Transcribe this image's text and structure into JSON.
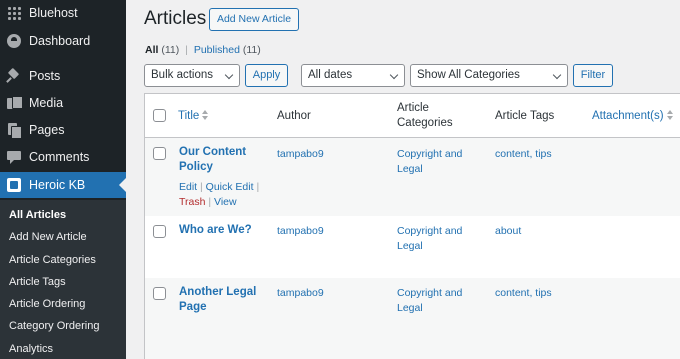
{
  "sidebar": {
    "top_items": [
      {
        "label": "Bluehost",
        "icon": "grid-icon"
      },
      {
        "label": "Dashboard",
        "icon": "dashboard-icon"
      },
      {
        "label": "Posts",
        "icon": "pin-icon"
      },
      {
        "label": "Media",
        "icon": "media-icon"
      },
      {
        "label": "Pages",
        "icon": "pages-icon"
      },
      {
        "label": "Comments",
        "icon": "comment-icon"
      },
      {
        "label": "Heroic KB",
        "icon": "kb-icon"
      }
    ],
    "submenu": [
      "All Articles",
      "Add New Article",
      "Article Categories",
      "Article Tags",
      "Article Ordering",
      "Category Ordering",
      "Analytics"
    ],
    "colors": {
      "background": "#1d2327",
      "current": "#2271b1",
      "submenu": "#2c3338"
    }
  },
  "header": {
    "title": "Articles",
    "add_new_label": "Add New Article"
  },
  "views": {
    "all_label": "All",
    "all_count": "(11)",
    "separator": "|",
    "published_label": "Published",
    "published_count": "(11)"
  },
  "filters": {
    "bulk_actions": "Bulk actions",
    "apply_label": "Apply",
    "dates": "All dates",
    "categories": "Show All Categories",
    "filter_label": "Filter"
  },
  "table": {
    "columns": {
      "title": "Title",
      "author": "Author",
      "categories_line1": "Article",
      "categories_line2": "Categories",
      "tags": "Article Tags",
      "attachments": "Attachment(s)"
    },
    "rows": [
      {
        "title_line1": "Our Content",
        "title_line2": "Policy",
        "author": "tampabo9",
        "category_line1": "Copyright and",
        "category_line2": "Legal",
        "tags": "content, tips",
        "actions": {
          "edit": "Edit",
          "quick_edit": "Quick Edit",
          "trash": "Trash",
          "view": "View",
          "sep": "|"
        }
      },
      {
        "title_line1": "Who are We?",
        "title_line2": "",
        "author": "tampabo9",
        "category_line1": "Copyright and",
        "category_line2": "Legal",
        "tags": "about"
      },
      {
        "title_line1": "Another Legal",
        "title_line2": "Page",
        "author": "tampabo9",
        "category_line1": "Copyright and",
        "category_line2": "Legal",
        "tags": "content, tips"
      }
    ]
  },
  "colors": {
    "link": "#2271b1",
    "trash": "#b32d2e",
    "page_bg": "#f0f0f1"
  }
}
